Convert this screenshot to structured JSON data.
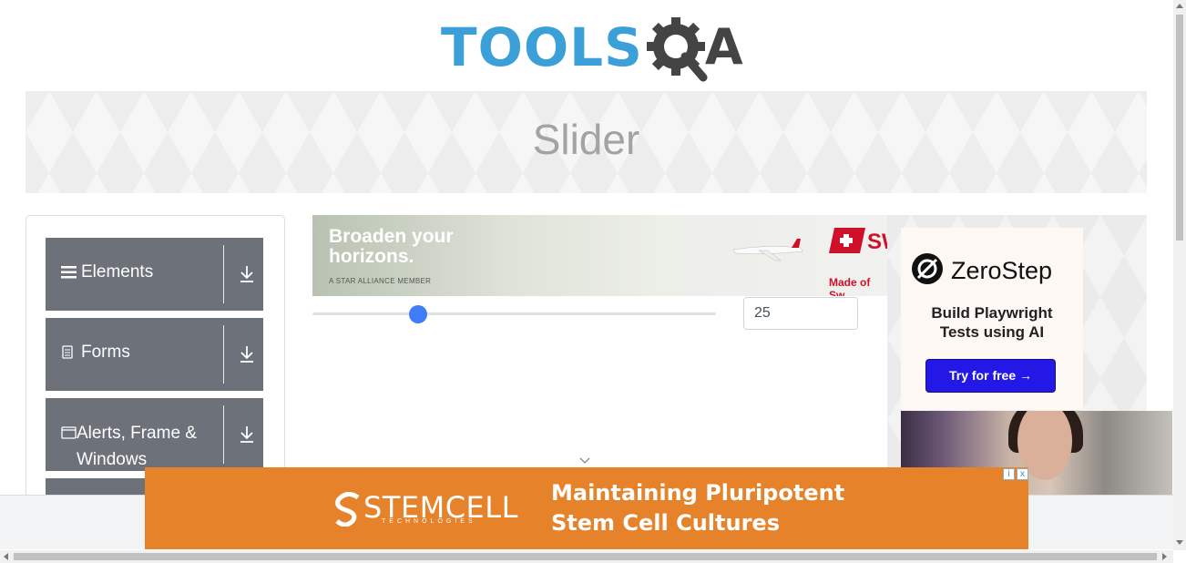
{
  "header": {
    "logo_text": "TOOLS",
    "logo_suffix": "A"
  },
  "banner": {
    "title": "Slider"
  },
  "sidebar": {
    "groups": [
      {
        "label": "Elements",
        "icon": "hamburger-icon"
      },
      {
        "label": "Forms",
        "icon": "document-icon"
      },
      {
        "label": "Alerts, Frame & Windows",
        "icon": "window-icon"
      }
    ]
  },
  "ad_top": {
    "headline": "Broaden your horizons.",
    "tagline": "A STAR ALLIANCE MEMBER",
    "brand_partial": "SW",
    "made_of": "Made of Sw"
  },
  "slider": {
    "value": "25",
    "min": 0,
    "max": 100,
    "accent": "#3f7cf7"
  },
  "ad_right": {
    "brand": "ZeroStep",
    "text": "Build Playwright Tests using AI",
    "cta": "Try for free →"
  },
  "ad_bottom": {
    "brand": "STEMCELL",
    "brand_sub": "TECHNOLOGIES",
    "tagline_line1": "Maintaining Pluripotent",
    "tagline_line2": "Stem Cell Cultures",
    "adchoices_info": "i",
    "adchoices_close": "x"
  },
  "colors": {
    "logo_blue": "#3b9fd8",
    "logo_dark": "#444444",
    "sidebar_group": "#6d7179",
    "ad_orange": "#e5822a",
    "cta_blue": "#2418e6"
  }
}
